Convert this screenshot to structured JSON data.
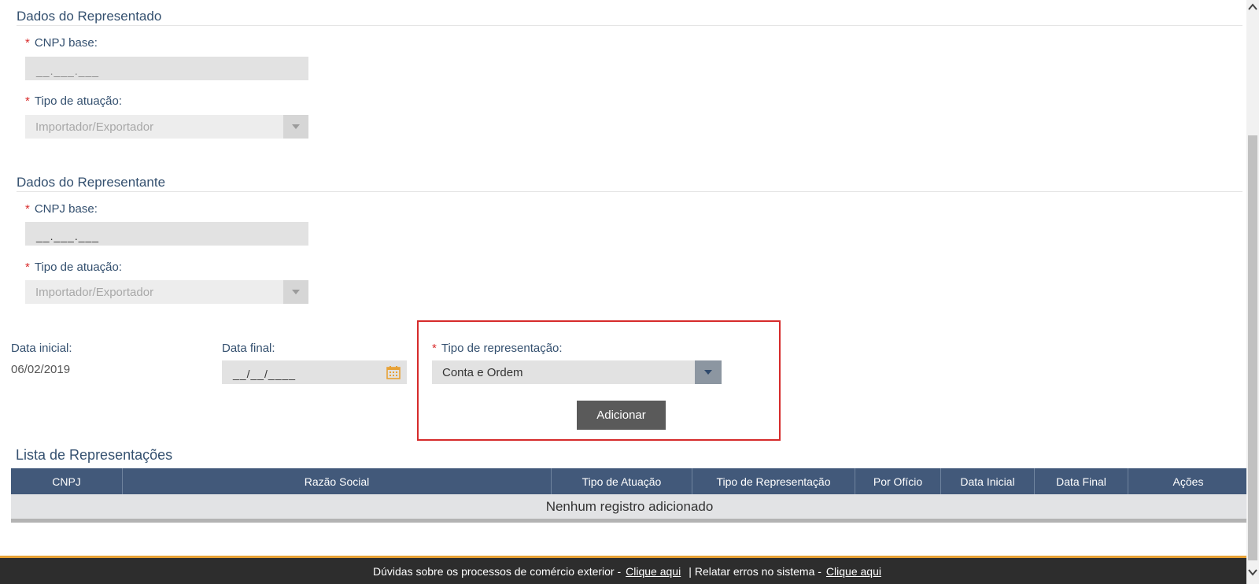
{
  "representado": {
    "title": "Dados do Representado",
    "cnpj_label": "CNPJ base:",
    "cnpj_placeholder": "__.___.___",
    "tipo_label": "Tipo de atuação:",
    "tipo_value": "Importador/Exportador"
  },
  "representante": {
    "title": "Dados do Representante",
    "cnpj_label": "CNPJ base:",
    "cnpj_placeholder": "__.___.___",
    "tipo_label": "Tipo de atuação:",
    "tipo_value": "Importador/Exportador"
  },
  "required_mark": "*",
  "datas": {
    "inicial_label": "Data inicial:",
    "inicial_value": "06/02/2019",
    "final_label": "Data final:",
    "final_placeholder": "__/__/____"
  },
  "representacao": {
    "label": "Tipo de representação:",
    "value": "Conta e Ordem",
    "add_button": "Adicionar"
  },
  "lista": {
    "title": "Lista de Representações",
    "columns": [
      "CNPJ",
      "Razão Social",
      "Tipo de Atuação",
      "Tipo de Representação",
      "Por Ofício",
      "Data Inicial",
      "Data Final",
      "Ações"
    ],
    "empty_message": "Nenhum registro adicionado"
  },
  "footer": {
    "text1": "Dúvidas sobre os processos de comércio exterior -",
    "link1": "Clique aqui",
    "separator": "|",
    "text2": "Relatar erros no sistema -",
    "link2": "Clique aqui"
  },
  "colors": {
    "header_blue": "#42597a",
    "highlight_red": "#d62b2b",
    "footer_accent": "#e7a135"
  }
}
